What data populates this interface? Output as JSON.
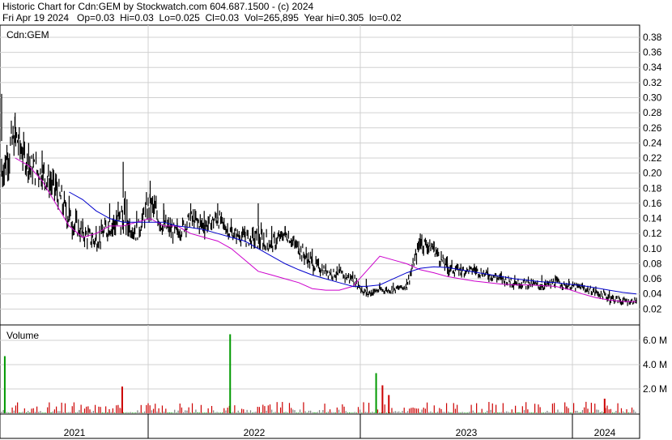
{
  "header": {
    "line1": "Historic Chart for Cdn:GEM by Stockwatch.com 604.687.1500 - (c) 2024",
    "line2": "Fri Apr 19 2024   Op=0.03  Hi=0.03  Lo=0.025  Cl=0.03  Vol=265,895  Year hi=0.305  lo=0.02"
  },
  "colors": {
    "price": "#000000",
    "ma_short": "#cc00cc",
    "ma_long": "#0000cc",
    "vol_up": "#cc0000",
    "vol_down": "#808080",
    "vol_other": "#009900",
    "grid": "#d0d0d0"
  },
  "chart_data": [
    {
      "type": "line",
      "title": "Cdn:GEM",
      "y_ticks": [
        "0.02",
        "0.04",
        "0.06",
        "0.08",
        "0.10",
        "0.12",
        "0.14",
        "0.16",
        "0.18",
        "0.20",
        "0.22",
        "0.24",
        "0.26",
        "0.28",
        "0.30",
        "0.32",
        "0.34",
        "0.36",
        "0.38"
      ],
      "ylim": [
        0.0,
        0.395
      ],
      "x_labels": [
        "2021",
        "2022",
        "2023",
        "2024"
      ],
      "x": [
        "2020-09",
        "2020-10",
        "2020-11",
        "2020-12",
        "2021-01",
        "2021-02",
        "2021-03",
        "2021-04",
        "2021-05",
        "2021-06",
        "2021-07",
        "2021-08",
        "2021-09",
        "2021-10",
        "2021-11",
        "2021-12",
        "2022-01",
        "2022-02",
        "2022-03",
        "2022-04",
        "2022-05",
        "2022-06",
        "2022-07",
        "2022-08",
        "2022-09",
        "2022-10",
        "2022-11",
        "2022-12",
        "2023-01",
        "2023-02",
        "2023-03",
        "2023-04",
        "2023-05",
        "2023-06",
        "2023-07",
        "2023-08",
        "2023-09",
        "2023-10",
        "2023-11",
        "2023-12",
        "2024-01",
        "2024-02",
        "2024-03",
        "2024-04"
      ],
      "series": [
        {
          "values": [
            0.2,
            0.25,
            0.21,
            0.2,
            0.18,
            0.14,
            0.12,
            0.11,
            0.13,
            0.14,
            0.12,
            0.16,
            0.13,
            0.12,
            0.14,
            0.13,
            0.14,
            0.12,
            0.115,
            0.11,
            0.105,
            0.12,
            0.1,
            0.08,
            0.07,
            0.065,
            0.06,
            0.04,
            0.045,
            0.045,
            0.05,
            0.11,
            0.1,
            0.075,
            0.07,
            0.072,
            0.065,
            0.06,
            0.055,
            0.053,
            0.05,
            0.055,
            0.05,
            0.048,
            0.042,
            0.035,
            0.03,
            0.03
          ],
          "high": [
            0.305,
            0.28,
            0.24,
            0.23,
            0.2,
            0.17,
            0.14,
            0.13,
            0.16,
            0.215,
            0.15,
            0.19,
            0.16,
            0.14,
            0.16,
            0.15,
            0.16,
            0.14,
            0.13,
            0.16,
            0.13,
            0.13,
            0.11,
            0.1,
            0.08,
            0.08,
            0.07,
            0.06,
            0.055,
            0.055,
            0.06,
            0.12,
            0.11,
            0.09,
            0.08,
            0.08,
            0.075,
            0.07,
            0.065,
            0.063,
            0.065,
            0.065,
            0.06,
            0.055,
            0.05,
            0.045,
            0.035,
            0.035
          ],
          "low": [
            0.18,
            0.2,
            0.18,
            0.17,
            0.14,
            0.11,
            0.1,
            0.09,
            0.11,
            0.12,
            0.11,
            0.13,
            0.11,
            0.105,
            0.12,
            0.11,
            0.12,
            0.11,
            0.1,
            0.1,
            0.095,
            0.1,
            0.08,
            0.065,
            0.06,
            0.055,
            0.05,
            0.035,
            0.04,
            0.04,
            0.045,
            0.08,
            0.08,
            0.06,
            0.06,
            0.06,
            0.055,
            0.05,
            0.045,
            0.045,
            0.045,
            0.045,
            0.045,
            0.04,
            0.035,
            0.025,
            0.02,
            0.025
          ]
        },
        {
          "values": [
            null,
            0.22,
            0.21,
            0.19,
            0.16,
            0.13,
            0.115,
            0.12,
            0.13,
            0.13,
            0.135,
            0.14,
            0.13,
            0.13,
            0.12,
            0.115,
            0.11,
            0.1,
            0.085,
            0.07,
            0.065,
            0.06,
            0.055,
            0.047,
            0.045,
            0.045,
            0.05,
            0.07,
            0.09,
            0.085,
            0.08,
            0.072,
            0.068,
            0.063,
            0.06,
            0.057,
            0.055,
            0.053,
            0.052,
            0.052,
            0.051,
            0.05,
            0.046,
            0.04,
            0.035,
            0.032,
            0.03,
            0.03
          ]
        },
        {
          "values": [
            null,
            null,
            null,
            null,
            null,
            0.175,
            0.165,
            0.15,
            0.14,
            0.135,
            0.135,
            0.135,
            0.135,
            0.13,
            0.128,
            0.125,
            0.12,
            0.115,
            0.11,
            0.1,
            0.09,
            0.08,
            0.072,
            0.065,
            0.06,
            0.055,
            0.05,
            0.05,
            0.052,
            0.06,
            0.068,
            0.074,
            0.076,
            0.075,
            0.072,
            0.069,
            0.066,
            0.063,
            0.06,
            0.058,
            0.056,
            0.055,
            0.053,
            0.051,
            0.048,
            0.045,
            0.042,
            0.04
          ]
        }
      ]
    },
    {
      "type": "bar",
      "title": "Volume",
      "y_ticks": [
        "2.0 M",
        "4.0 M",
        "6.0 M"
      ],
      "ylim": [
        0,
        7.2
      ],
      "spikes": [
        {
          "t": 0.005,
          "v": 4.7,
          "c": "green"
        },
        {
          "t": 0.19,
          "v": 2.2,
          "c": "red"
        },
        {
          "t": 0.36,
          "v": 6.5,
          "c": "green"
        },
        {
          "t": 0.59,
          "v": 3.3,
          "c": "green"
        },
        {
          "t": 0.6,
          "v": 2.3,
          "c": "red"
        },
        {
          "t": 0.61,
          "v": 1.5,
          "c": "red"
        },
        {
          "t": 0.95,
          "v": 1.2,
          "c": "red"
        }
      ]
    }
  ]
}
